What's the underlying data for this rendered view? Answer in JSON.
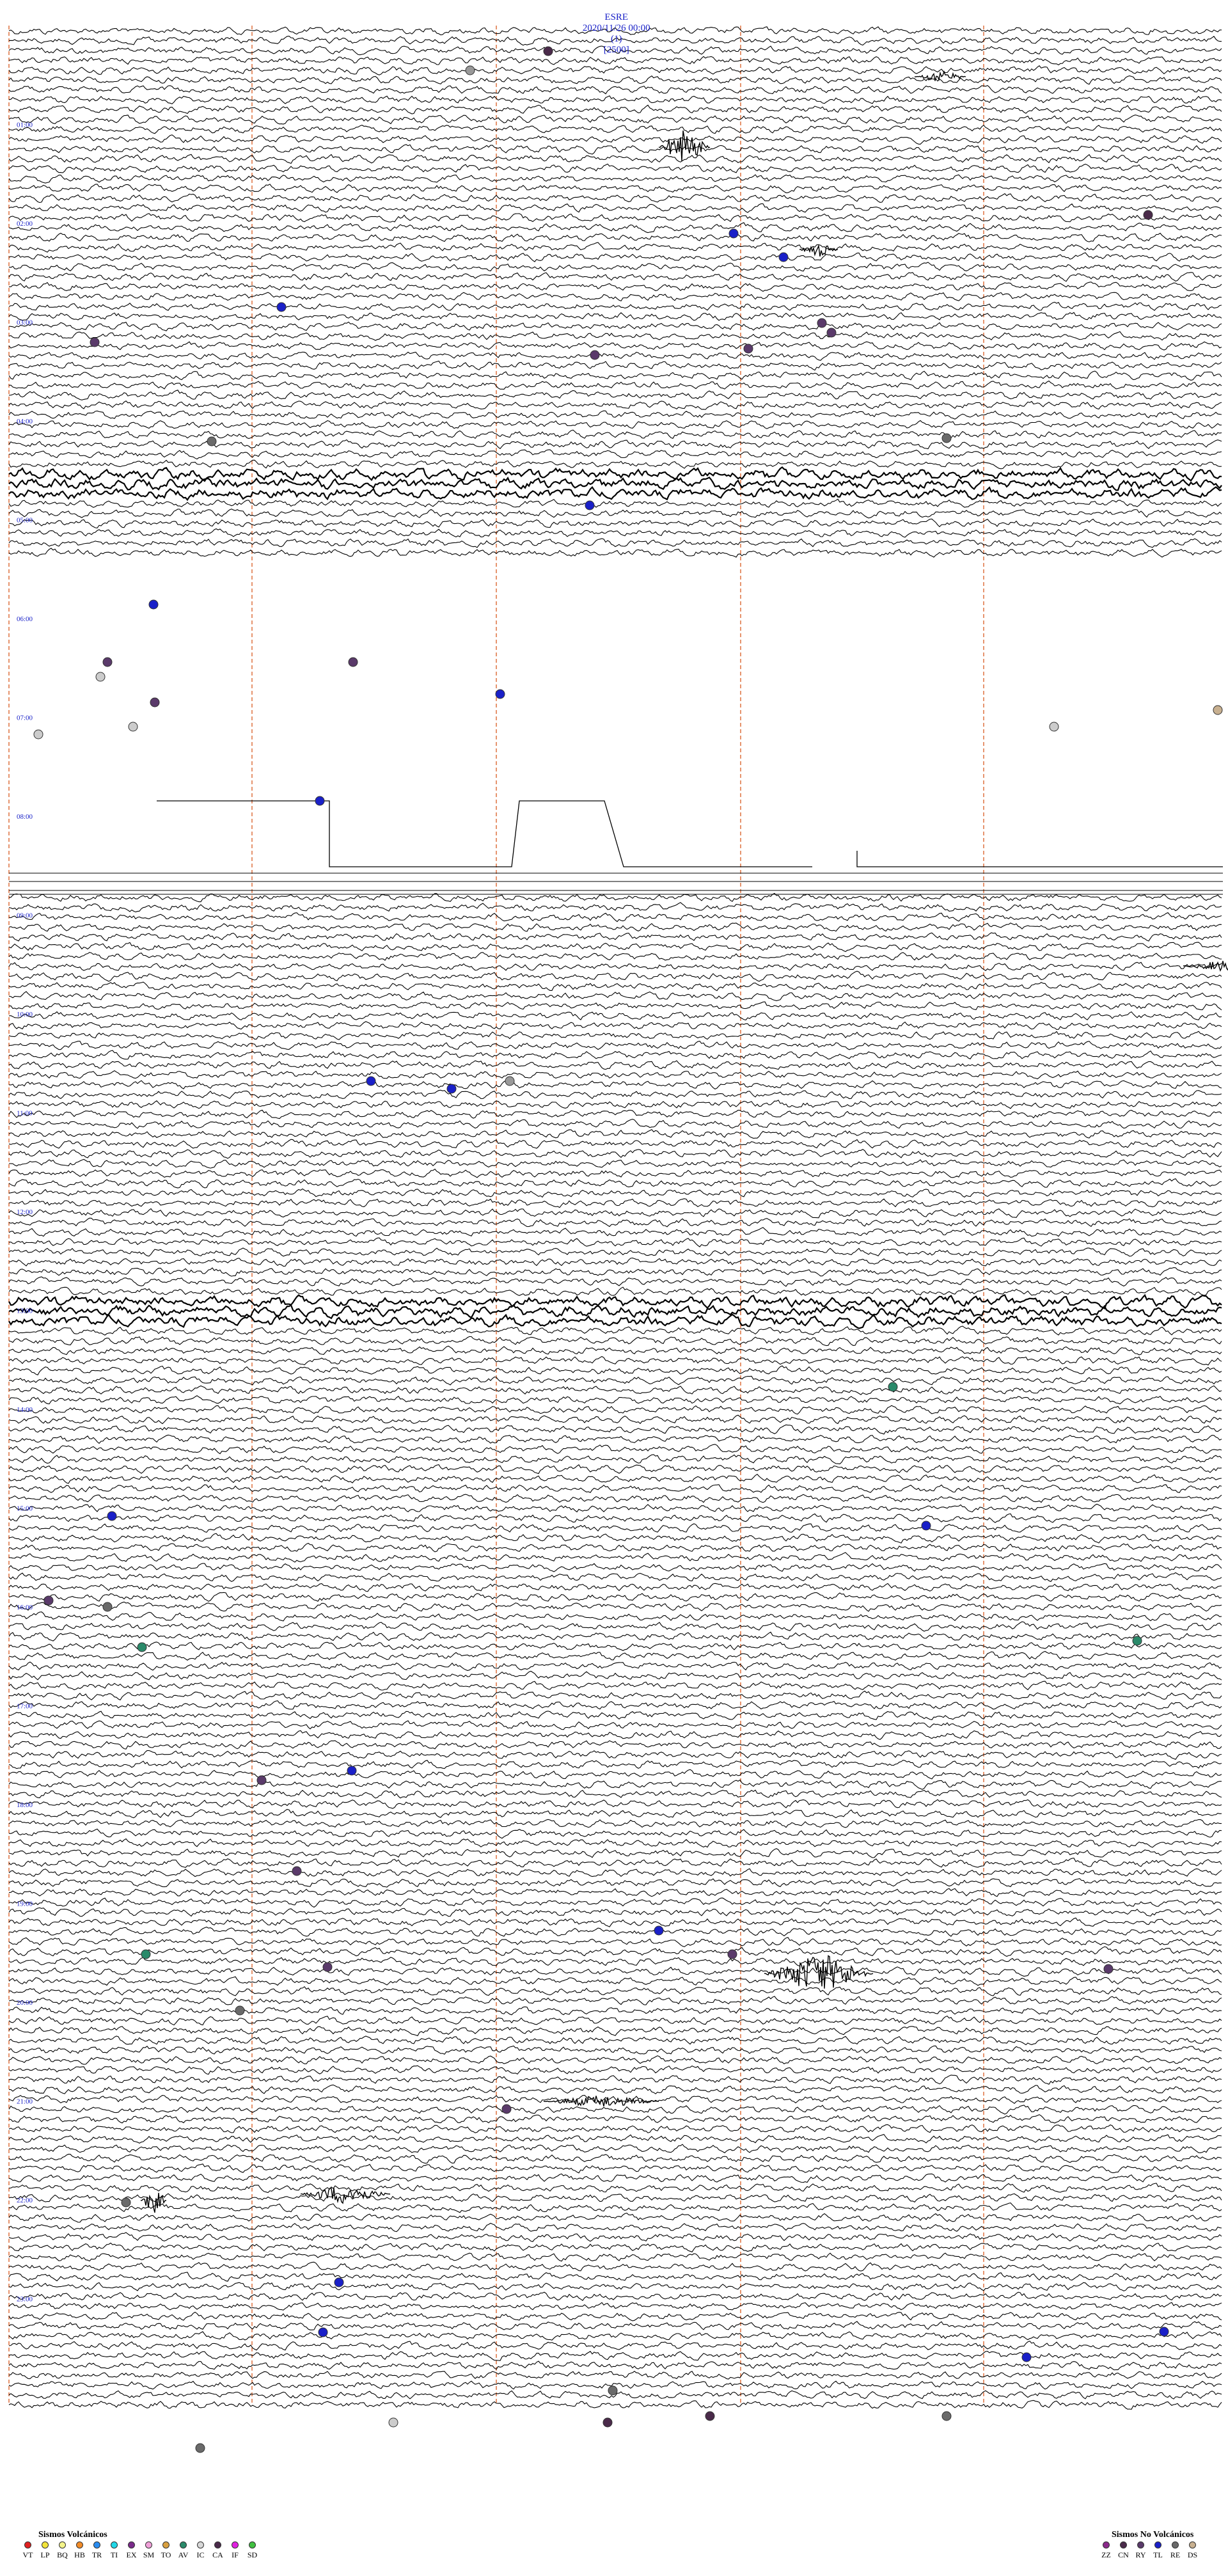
{
  "header": {
    "station": "ESRE",
    "datetime": "2020/11/26 00:00",
    "channel": "(1)",
    "scale": "[2500]"
  },
  "chart_data": {
    "type": "helicorder",
    "title": "ESRE    2020/11/26 00:00    (1)    [2500]",
    "hour_labels": [
      "01:00",
      "02:00",
      "03:00",
      "04:00",
      "05:00",
      "06:00",
      "07:00",
      "08:00",
      "09:00",
      "10:00",
      "11:00",
      "12:00",
      "13:00",
      "14:00",
      "15:00",
      "16:00",
      "17:00",
      "18:00",
      "19:00",
      "20:00",
      "21:00",
      "22:00",
      "23:00"
    ],
    "grid_color": "#e07a4a",
    "trace_color": "#000000",
    "hour_label_color": "#1a22c8"
  },
  "legend": {
    "volcanic_title": "Sismos Volcánicos",
    "volcanic": [
      {
        "code": "VT",
        "color": "#e02020"
      },
      {
        "code": "LP",
        "color": "#f2e43a"
      },
      {
        "code": "BQ",
        "color": "#f4f48a"
      },
      {
        "code": "HB",
        "color": "#f28c28"
      },
      {
        "code": "TR",
        "color": "#2a8cf0"
      },
      {
        "code": "TI",
        "color": "#22d8e8"
      },
      {
        "code": "EX",
        "color": "#7a2a8a"
      },
      {
        "code": "SM",
        "color": "#f0a0d8"
      },
      {
        "code": "TO",
        "color": "#d8a040"
      },
      {
        "code": "AV",
        "color": "#2a8a6a"
      },
      {
        "code": "IC",
        "color": "#d8d8d8"
      },
      {
        "code": "CA",
        "color": "#4a2a4a"
      },
      {
        "code": "IF",
        "color": "#e020e0"
      },
      {
        "code": "SD",
        "color": "#40c040"
      }
    ],
    "nonvolcanic_title": "Sismos No Volcánicos",
    "nonvolcanic": [
      {
        "code": "ZZ",
        "color": "#8a2a8a"
      },
      {
        "code": "CN",
        "color": "#4a2a4a"
      },
      {
        "code": "RY",
        "color": "#5a3a6a"
      },
      {
        "code": "TL",
        "color": "#1a20c8"
      },
      {
        "code": "RE",
        "color": "#6a6a6a"
      },
      {
        "code": "DS",
        "color": "#c8b090"
      }
    ]
  }
}
